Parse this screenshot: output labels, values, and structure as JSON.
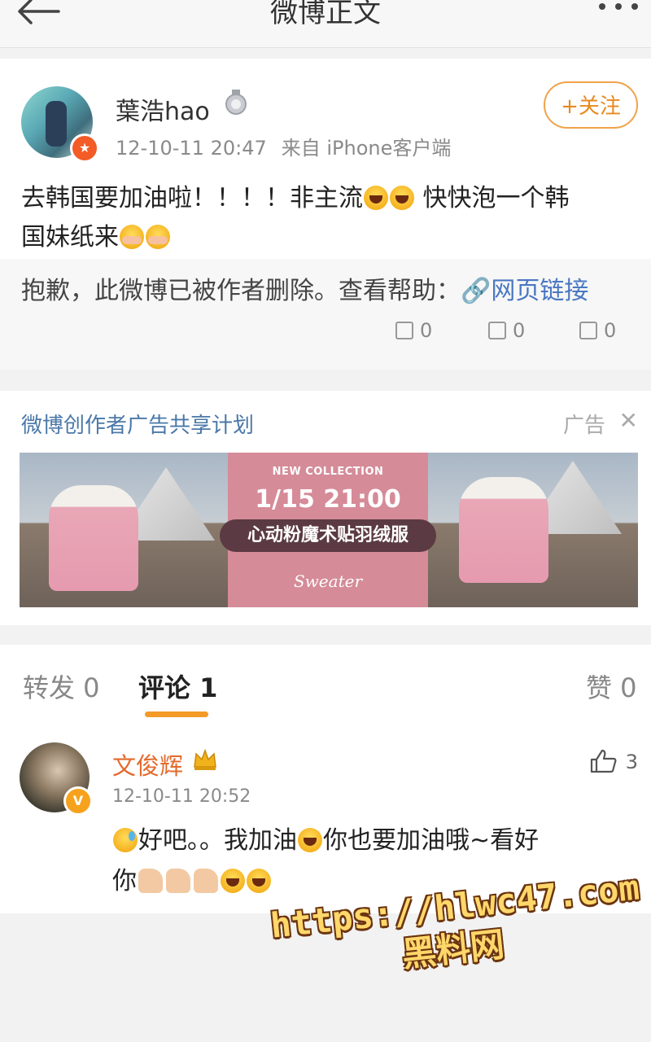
{
  "header": {
    "title": "微博正文",
    "back_icon": "arrow-left-icon",
    "more_icon": "more-dots-icon"
  },
  "post": {
    "username": "葉浩hao",
    "time": "12-10-11 20:47",
    "source": "来自 iPhone客户端",
    "follow_label": "+关注",
    "text_line1": "去韩国要加油啦！！！！非主流",
    "text_line1b": "快快泡一个韩",
    "text_line2": "国妹纸来",
    "deleted_prefix": "抱歉，此微博已被作者删除。查看帮助：",
    "deleted_link": "网页链接",
    "repost_count": "0",
    "comment_count": "0",
    "like_count": "0"
  },
  "ad": {
    "title": "微博创作者广告共享计划",
    "label": "广告",
    "close_icon": "close-icon",
    "banner": {
      "headline": "NEW COLLECTION",
      "date": "1/15 21:00",
      "slogan": "心动粉魔术贴羽绒服",
      "script": "Sweater"
    }
  },
  "tabs": {
    "repost": "转发 0",
    "comment": "评论 1",
    "like": "赞 0"
  },
  "comment": {
    "name": "文俊辉",
    "time": "12-10-11 20:52",
    "likes": "3",
    "text_a": "好吧。。我加油",
    "text_b": "你也要加油哦~看好",
    "text_c": "你"
  },
  "watermark": {
    "line1": "https://hlwc47.com",
    "line2": "黑料网"
  },
  "colors": {
    "accent": "#f39a27",
    "link": "#4a78c2",
    "name_orange": "#e36a2d"
  }
}
